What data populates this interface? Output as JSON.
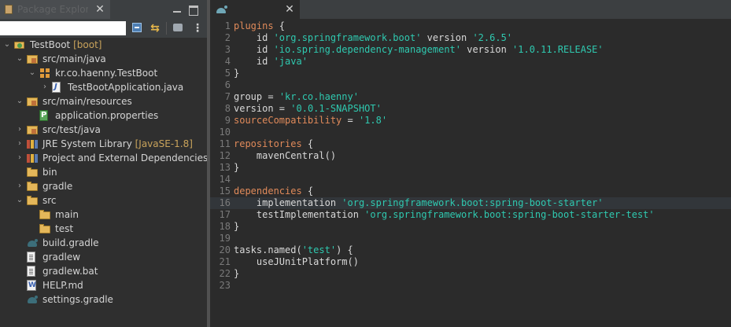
{
  "package_explorer": {
    "tab_label": "Package Explorer",
    "close_glyph": "✕",
    "filter_value": "",
    "menu_glyph": "⋮",
    "link_glyph": "⇆"
  },
  "tree": [
    {
      "label": "TestBoot",
      "decoration": " [boot]",
      "icon": "project-icon",
      "twisty": "⌄",
      "depth": 0
    },
    {
      "label": "src/main/java",
      "decoration": "",
      "icon": "source-folder-icon",
      "twisty": "⌄",
      "depth": 1
    },
    {
      "label": "kr.co.haenny.TestBoot",
      "decoration": "",
      "icon": "package-icon",
      "twisty": "⌄",
      "depth": 2
    },
    {
      "label": "TestBootApplication.java",
      "decoration": "",
      "icon": "java-file-icon",
      "twisty": "›",
      "depth": 3
    },
    {
      "label": "src/main/resources",
      "decoration": "",
      "icon": "source-folder-icon",
      "twisty": "⌄",
      "depth": 1
    },
    {
      "label": "application.properties",
      "decoration": "",
      "icon": "properties-file-icon",
      "twisty": "",
      "depth": 2
    },
    {
      "label": "src/test/java",
      "decoration": "",
      "icon": "source-folder-icon",
      "twisty": "›",
      "depth": 1
    },
    {
      "label": "JRE System Library",
      "decoration": " [JavaSE-1.8]",
      "icon": "library-icon",
      "twisty": "›",
      "depth": 1
    },
    {
      "label": "Project and External Dependencies",
      "decoration": "",
      "icon": "library-icon",
      "twisty": "›",
      "depth": 1
    },
    {
      "label": "bin",
      "decoration": "",
      "icon": "folder-icon",
      "twisty": "",
      "depth": 1
    },
    {
      "label": "gradle",
      "decoration": "",
      "icon": "folder-icon",
      "twisty": "›",
      "depth": 1
    },
    {
      "label": "src",
      "decoration": "",
      "icon": "folder-icon",
      "twisty": "⌄",
      "depth": 1
    },
    {
      "label": "main",
      "decoration": "",
      "icon": "folder-icon",
      "twisty": "",
      "depth": 2
    },
    {
      "label": "test",
      "decoration": "",
      "icon": "folder-icon",
      "twisty": "",
      "depth": 2
    },
    {
      "label": "build.gradle",
      "decoration": "",
      "icon": "gradle-file-icon",
      "twisty": "",
      "depth": 1
    },
    {
      "label": "gradlew",
      "decoration": "",
      "icon": "text-file-icon",
      "twisty": "",
      "depth": 1
    },
    {
      "label": "gradlew.bat",
      "decoration": "",
      "icon": "text-file-icon",
      "twisty": "",
      "depth": 1
    },
    {
      "label": "HELP.md",
      "decoration": "",
      "icon": "markdown-file-icon",
      "twisty": "",
      "depth": 1
    },
    {
      "label": "settings.gradle",
      "decoration": "",
      "icon": "gradle-file-icon",
      "twisty": "",
      "depth": 1
    }
  ],
  "editor": {
    "tab_close_glyph": "✕",
    "highlighted_line": 16,
    "lines": [
      [
        [
          "plugins",
          "kw"
        ],
        [
          " {",
          ""
        ]
      ],
      [
        [
          "    id ",
          ""
        ],
        [
          "'org.springframework.boot'",
          "str"
        ],
        [
          " version ",
          ""
        ],
        [
          "'2.6.5'",
          "str"
        ]
      ],
      [
        [
          "    id ",
          ""
        ],
        [
          "'io.spring.dependency-management'",
          "str"
        ],
        [
          " version ",
          ""
        ],
        [
          "'1.0.11.RELEASE'",
          "str"
        ]
      ],
      [
        [
          "    id ",
          ""
        ],
        [
          "'java'",
          "str"
        ]
      ],
      [
        [
          "}",
          ""
        ]
      ],
      [],
      [
        [
          "group",
          ""
        ],
        [
          " = ",
          ""
        ],
        [
          "'kr.co.haenny'",
          "str"
        ]
      ],
      [
        [
          "version",
          ""
        ],
        [
          " = ",
          ""
        ],
        [
          "'0.0.1-SNAPSHOT'",
          "str"
        ]
      ],
      [
        [
          "sourceCompatibility",
          "kw"
        ],
        [
          " = ",
          ""
        ],
        [
          "'1.8'",
          "str"
        ]
      ],
      [],
      [
        [
          "repositories",
          "kw"
        ],
        [
          " {",
          ""
        ]
      ],
      [
        [
          "    mavenCentral()",
          ""
        ]
      ],
      [
        [
          "}",
          ""
        ]
      ],
      [],
      [
        [
          "dependencies",
          "kw"
        ],
        [
          " {",
          ""
        ]
      ],
      [
        [
          "    implementation ",
          ""
        ],
        [
          "'org.springframework.boot:spring-boot-starter'",
          "str"
        ]
      ],
      [
        [
          "    testImplementation ",
          ""
        ],
        [
          "'org.springframework.boot:spring-boot-starter-test'",
          "str"
        ]
      ],
      [
        [
          "}",
          ""
        ]
      ],
      [],
      [
        [
          "tasks.named(",
          ""
        ],
        [
          "'test'",
          "str"
        ],
        [
          ") {",
          ""
        ]
      ],
      [
        [
          "    useJUnitPlatform()",
          ""
        ]
      ],
      [
        [
          "}",
          ""
        ]
      ],
      []
    ]
  },
  "colors": {
    "keyword": "#e08a5a",
    "string": "#2fc9b0",
    "editor_bg": "#2b2b2b"
  }
}
